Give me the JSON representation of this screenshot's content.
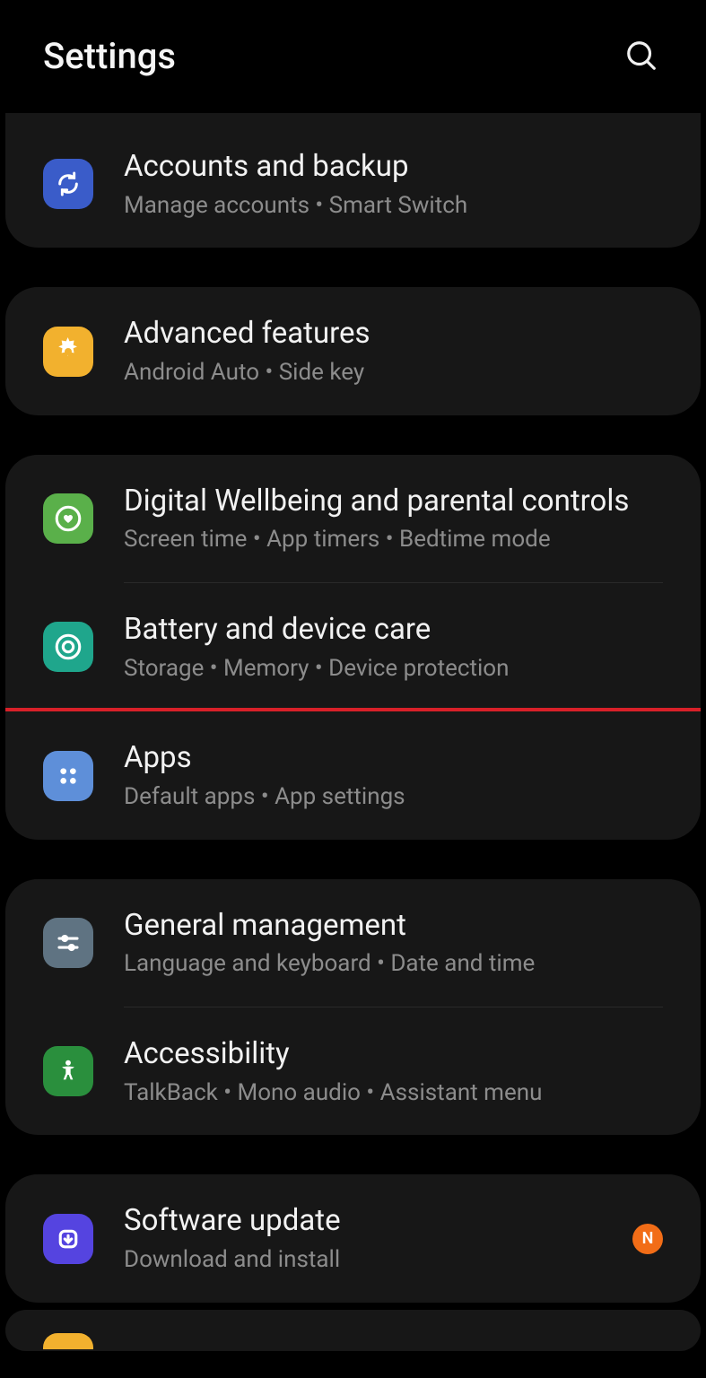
{
  "header": {
    "title": "Settings"
  },
  "groups": [
    {
      "items": [
        {
          "id": "accounts-backup",
          "icon": "sync",
          "bg": "#3a5cc9",
          "title": "Accounts and backup",
          "subtitle": "Manage accounts  •  Smart Switch"
        }
      ]
    },
    {
      "items": [
        {
          "id": "advanced-features",
          "icon": "gear-flower",
          "bg": "#f2b12e",
          "title": "Advanced features",
          "subtitle": "Android Auto  •  Side key"
        }
      ]
    },
    {
      "items": [
        {
          "id": "digital-wellbeing",
          "icon": "heart-circle",
          "bg": "#5ab04a",
          "title": "Digital Wellbeing and parental controls",
          "subtitle": "Screen time  •  App timers  •  Bedtime mode"
        },
        {
          "id": "battery-care",
          "icon": "target-circle",
          "bg": "#1fa68c",
          "title": "Battery and device care",
          "subtitle": "Storage  •  Memory  •  Device protection"
        },
        {
          "id": "apps",
          "icon": "apps-grid",
          "bg": "#5e8fd9",
          "title": "Apps",
          "subtitle": "Default apps  •  App settings",
          "highlighted": true
        }
      ]
    },
    {
      "items": [
        {
          "id": "general-management",
          "icon": "sliders",
          "bg": "#5f7382",
          "title": "General management",
          "subtitle": "Language and keyboard  •  Date and time"
        },
        {
          "id": "accessibility",
          "icon": "accessibility-person",
          "bg": "#2a8f3d",
          "title": "Accessibility",
          "subtitle": "TalkBack  •  Mono audio  •  Assistant menu"
        }
      ]
    },
    {
      "items": [
        {
          "id": "software-update",
          "icon": "download-circle",
          "bg": "#5544e0",
          "title": "Software update",
          "subtitle": "Download and install",
          "badge": "N"
        }
      ]
    }
  ]
}
